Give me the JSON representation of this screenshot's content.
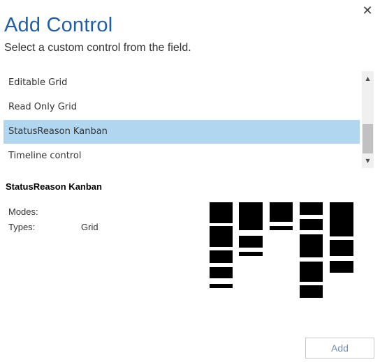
{
  "dialog": {
    "title": "Add Control",
    "subtitle": "Select a custom control from the field.",
    "close_glyph": "✕"
  },
  "controls_list": {
    "items": [
      {
        "label": "Editable Grid",
        "selected": false
      },
      {
        "label": "Read Only Grid",
        "selected": false
      },
      {
        "label": "StatusReason Kanban",
        "selected": true
      },
      {
        "label": "Timeline control",
        "selected": false
      }
    ],
    "scroll_up_glyph": "▲",
    "scroll_down_glyph": "▼"
  },
  "details": {
    "name": "StatusReason Kanban",
    "modes_label": "Modes:",
    "modes_value": "",
    "types_label": "Types:",
    "types_value": "Grid",
    "preview_icon": "kanban-board-icon"
  },
  "footer": {
    "add_label": "Add"
  },
  "colors": {
    "title": "#1f5ea8",
    "selected_row": "#b1d6f0",
    "add_button_text": "#6f8fb8"
  }
}
